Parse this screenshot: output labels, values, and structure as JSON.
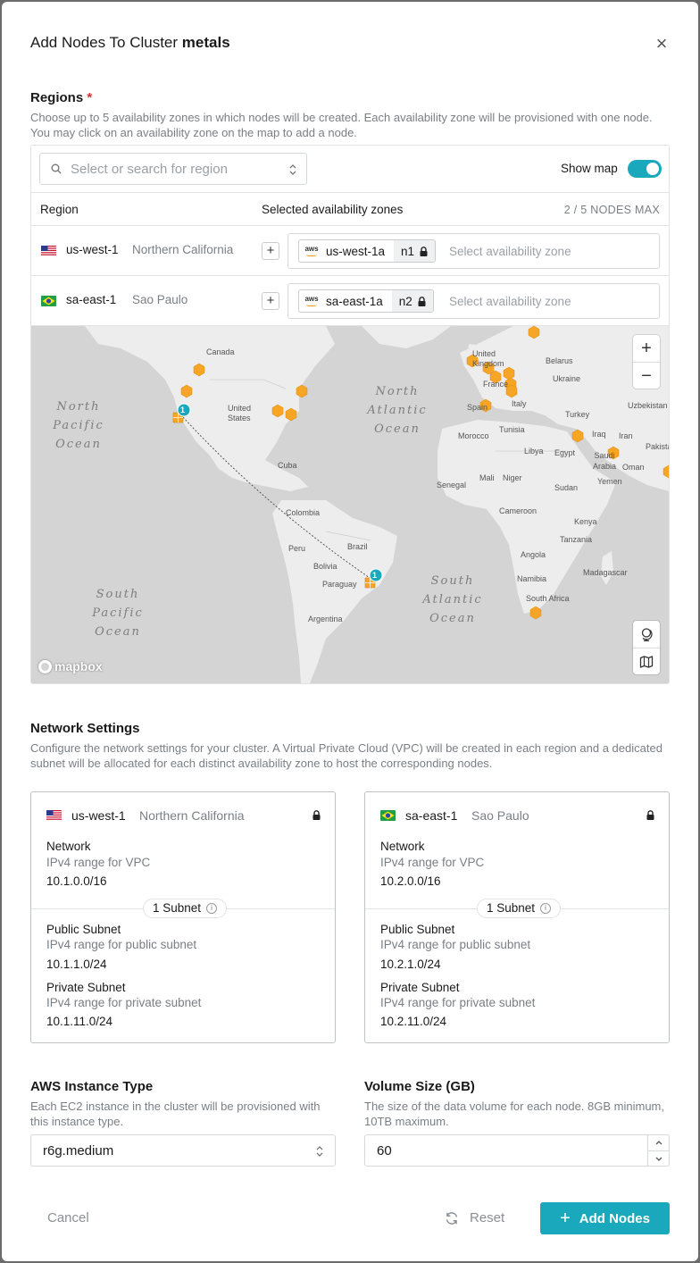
{
  "modal": {
    "title_prefix": "Add Nodes To Cluster ",
    "cluster_name": "metals",
    "close_icon": "close-icon"
  },
  "regions": {
    "title": "Regions",
    "required_mark": "*",
    "description": "Choose up to 5 availability zones in which nodes will be created. Each availability zone will be provisioned with one node. You may click on an availability zone on the map to add a node.",
    "search_placeholder": "Select or search for region",
    "show_map_label": "Show map",
    "show_map_on": true,
    "table": {
      "col_region": "Region",
      "col_zones": "Selected availability zones",
      "node_count": "2 / 5 NODES MAX"
    },
    "rows": [
      {
        "flag": "us",
        "region": "us-west-1",
        "location": "Northern California",
        "provider": "aws",
        "zone": "us-west-1a",
        "node": "n1",
        "zone_placeholder": "Select availability zone"
      },
      {
        "flag": "br",
        "region": "sa-east-1",
        "location": "Sao Paulo",
        "provider": "aws",
        "zone": "sa-east-1a",
        "node": "n2",
        "zone_placeholder": "Select availability zone"
      }
    ]
  },
  "map": {
    "labels": [
      "Canada",
      "United States",
      "Cuba",
      "Colombia",
      "Peru",
      "Brazil",
      "Bolivia",
      "Paraguay",
      "Argentina",
      "United Kingdom",
      "France",
      "Spain",
      "Italy",
      "Belarus",
      "Ukraine",
      "Turkey",
      "Uzbekistan",
      "Iraq",
      "Iran",
      "Pakistan",
      "Saudi Arabia",
      "Oman",
      "Yemen",
      "Egypt",
      "Libya",
      "Tunisia",
      "Morocco",
      "Mali",
      "Niger",
      "Senegal",
      "Sudan",
      "Cameroon",
      "Kenya",
      "Tanzania",
      "Angola",
      "Namibia",
      "Madagascar",
      "South Africa"
    ],
    "oceans": {
      "north_pacific": [
        "North",
        "Pacific",
        "Ocean"
      ],
      "north_atlantic": [
        "North",
        "Atlantic",
        "Ocean"
      ],
      "south_atlantic": [
        "South",
        "Atlantic",
        "Ocean"
      ],
      "south_pacific": [
        "South",
        "Pacific",
        "Ocean"
      ]
    },
    "marker_count_us": "1",
    "marker_count_sa": "1",
    "zoom_in": "+",
    "zoom_out": "−",
    "attribution": "mapbox",
    "zone_color": "#f7a526",
    "selected_color": "#1aa8bd"
  },
  "network": {
    "title": "Network Settings",
    "description": "Configure the network settings for your cluster. A Virtual Private Cloud (VPC) will be created in each region and a dedicated subnet will be allocated for each distinct availability zone to host the corresponding nodes.",
    "cards": [
      {
        "flag": "us",
        "region": "us-west-1",
        "location": "Northern California",
        "network_label": "Network",
        "network_sub": "IPv4 range for VPC",
        "network_value": "10.1.0.0/16",
        "subnet_pill": "1 Subnet",
        "public_label": "Public Subnet",
        "public_sub": "IPv4 range for public subnet",
        "public_value": "10.1.1.0/24",
        "private_label": "Private Subnet",
        "private_sub": "IPv4 range for private subnet",
        "private_value": "10.1.11.0/24"
      },
      {
        "flag": "br",
        "region": "sa-east-1",
        "location": "Sao Paulo",
        "network_label": "Network",
        "network_sub": "IPv4 range for VPC",
        "network_value": "10.2.0.0/16",
        "subnet_pill": "1 Subnet",
        "public_label": "Public Subnet",
        "public_sub": "IPv4 range for public subnet",
        "public_value": "10.2.1.0/24",
        "private_label": "Private Subnet",
        "private_sub": "IPv4 range for private subnet",
        "private_value": "10.2.11.0/24"
      }
    ]
  },
  "instance": {
    "title": "AWS Instance Type",
    "description": "Each EC2 instance in the cluster will be provisioned with this instance type.",
    "value": "r6g.medium"
  },
  "volume": {
    "title": "Volume Size (GB)",
    "description": "The size of the data volume for each node. 8GB minimum, 10TB maximum.",
    "value": "60"
  },
  "footer": {
    "cancel": "Cancel",
    "reset": "Reset",
    "add": "Add Nodes",
    "accent": "#1aa8bd"
  }
}
